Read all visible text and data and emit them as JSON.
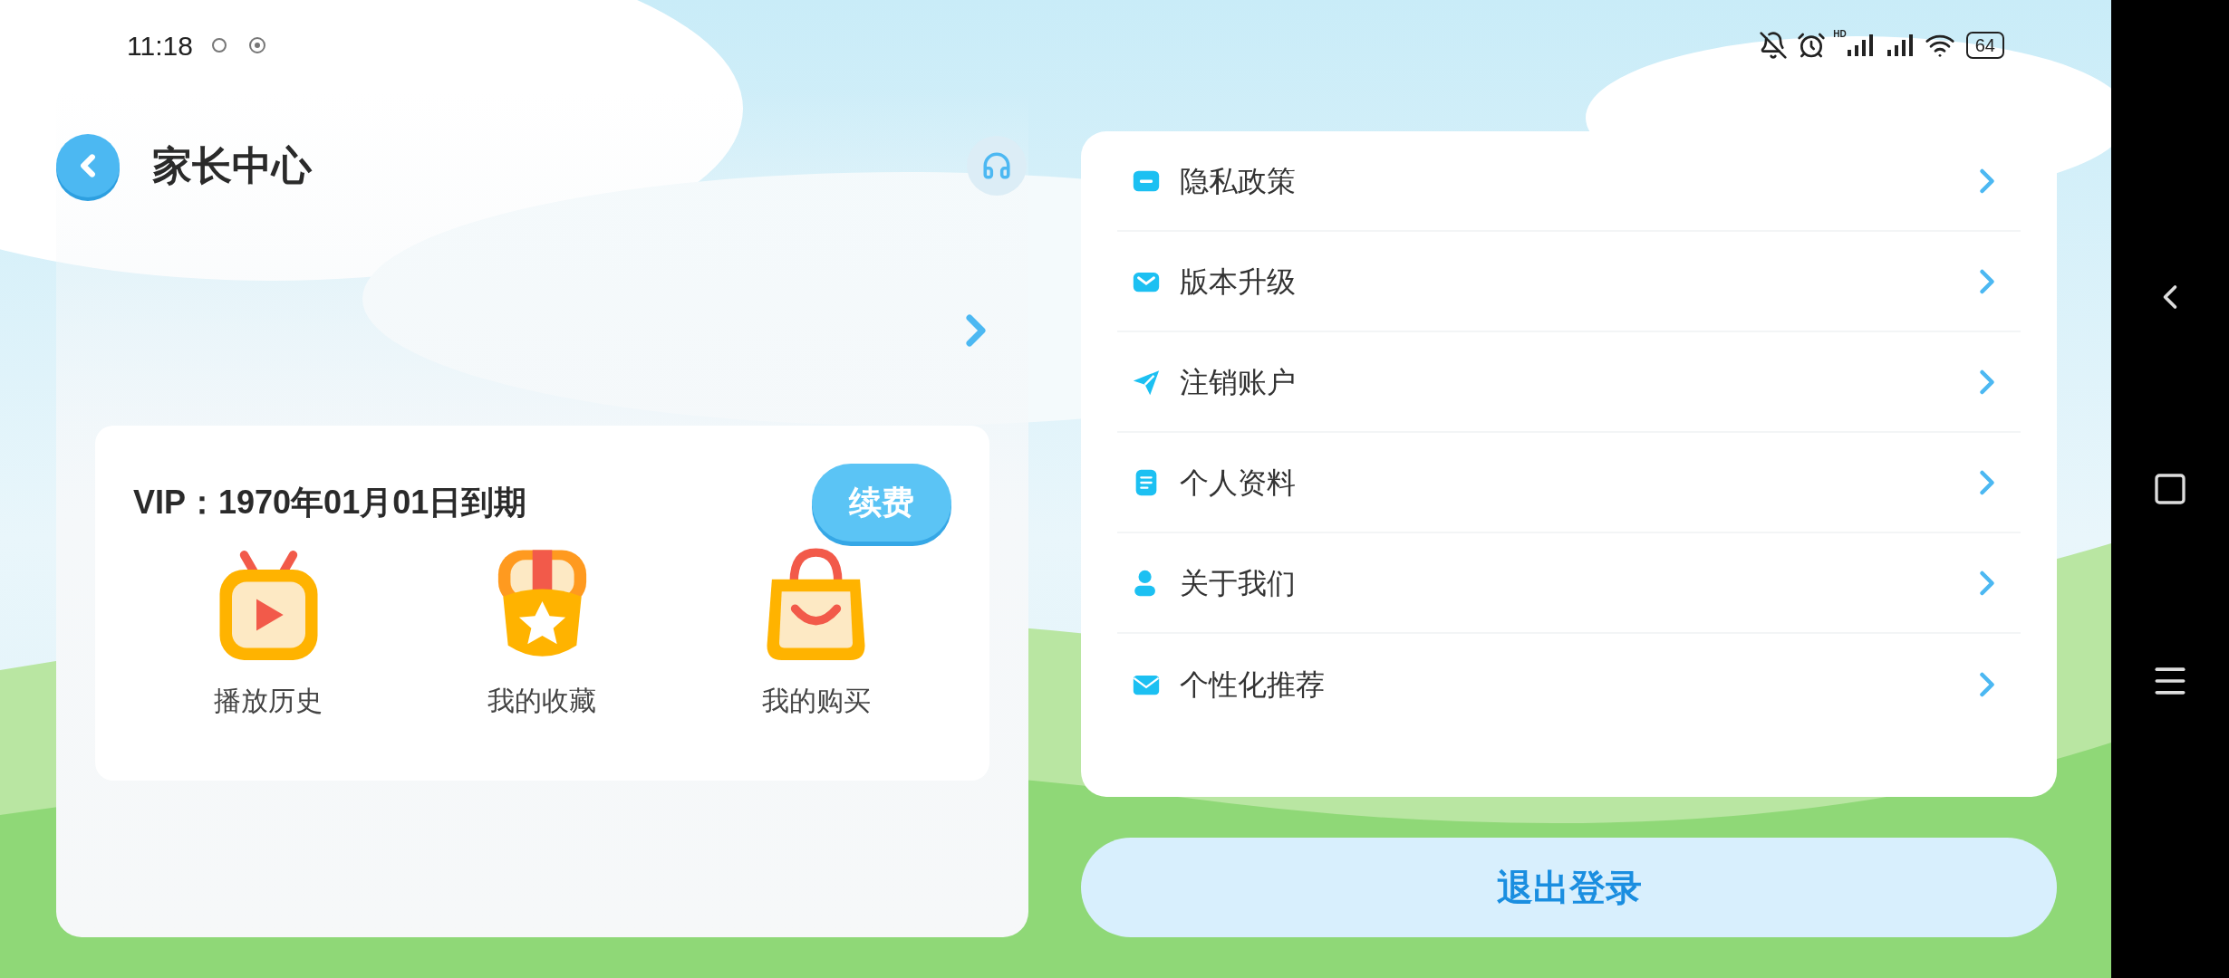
{
  "status_bar": {
    "time": "11:18",
    "network_label": "HD",
    "battery": "64"
  },
  "header": {
    "title": "家长中心"
  },
  "vip": {
    "text": "VIP：1970年01月01日到期",
    "button": "续费"
  },
  "shortcuts": [
    {
      "label": "播放历史",
      "kind": "history"
    },
    {
      "label": "我的收藏",
      "kind": "favorites"
    },
    {
      "label": "我的购买",
      "kind": "purchases"
    }
  ],
  "menu": [
    {
      "label": "隐私政策",
      "kind": "privacy"
    },
    {
      "label": "版本升级",
      "kind": "upgrade"
    },
    {
      "label": "注销账户",
      "kind": "cancel"
    },
    {
      "label": "个人资料",
      "kind": "profile"
    },
    {
      "label": "关于我们",
      "kind": "about"
    },
    {
      "label": "个性化推荐",
      "kind": "recommend"
    }
  ],
  "logout": "退出登录"
}
